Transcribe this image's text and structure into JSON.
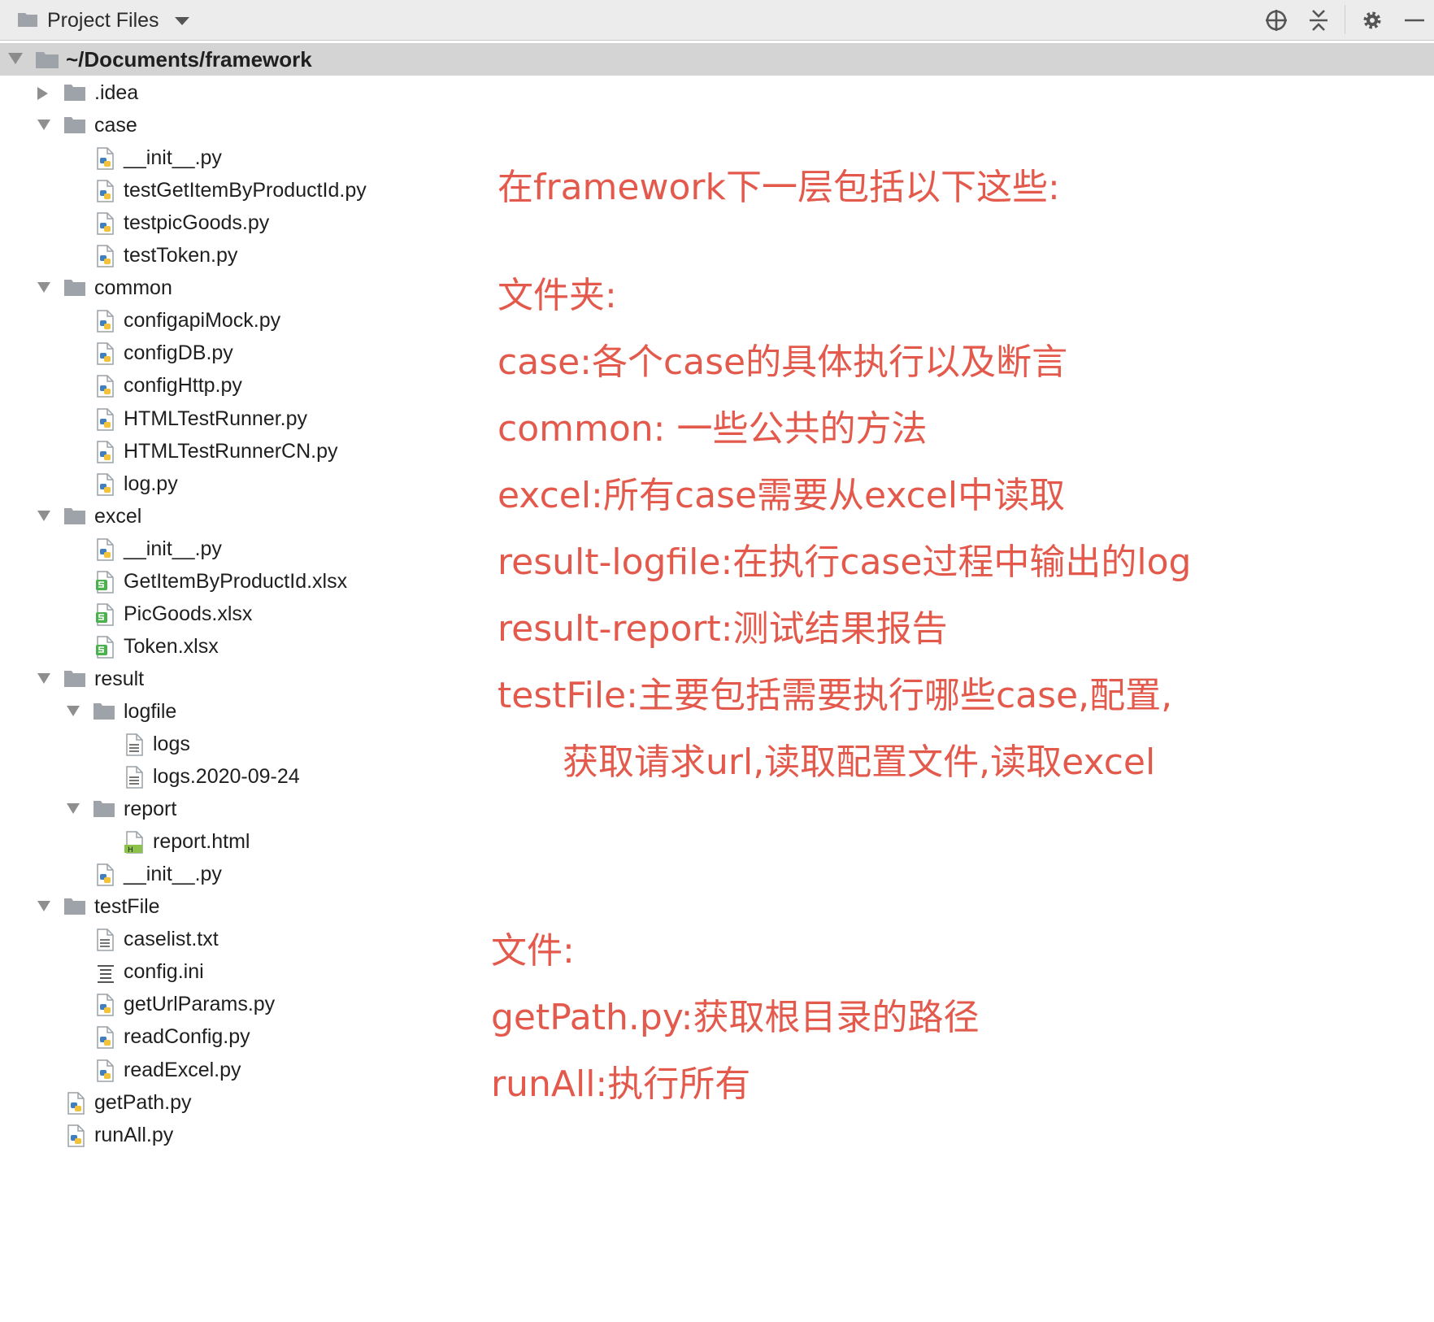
{
  "toolbar": {
    "title": "Project Files",
    "icons": [
      "folder-icon",
      "dropdown-caret-icon",
      "locate-target-icon",
      "collapse-all-icon",
      "gear-icon",
      "minimize-icon"
    ]
  },
  "tree": {
    "root_label": "~/Documents/framework",
    "items": [
      {
        "label": ".idea",
        "type": "folder",
        "expanded": false
      },
      {
        "label": "case",
        "type": "folder",
        "expanded": true
      },
      {
        "label": "__init__.py",
        "type": "python"
      },
      {
        "label": "testGetItemByProductId.py",
        "type": "python"
      },
      {
        "label": "testpicGoods.py",
        "type": "python"
      },
      {
        "label": "testToken.py",
        "type": "python"
      },
      {
        "label": "common",
        "type": "folder",
        "expanded": true
      },
      {
        "label": "configapiMock.py",
        "type": "python"
      },
      {
        "label": "configDB.py",
        "type": "python"
      },
      {
        "label": "configHttp.py",
        "type": "python"
      },
      {
        "label": "HTMLTestRunner.py",
        "type": "python"
      },
      {
        "label": "HTMLTestRunnerCN.py",
        "type": "python"
      },
      {
        "label": "log.py",
        "type": "python"
      },
      {
        "label": "excel",
        "type": "folder",
        "expanded": true
      },
      {
        "label": "__init__.py",
        "type": "python"
      },
      {
        "label": "GetItemByProductId.xlsx",
        "type": "excel"
      },
      {
        "label": "PicGoods.xlsx",
        "type": "excel"
      },
      {
        "label": "Token.xlsx",
        "type": "excel"
      },
      {
        "label": "result",
        "type": "folder",
        "expanded": true
      },
      {
        "label": "logfile",
        "type": "folder",
        "expanded": true
      },
      {
        "label": "logs",
        "type": "text"
      },
      {
        "label": "logs.2020-09-24",
        "type": "text"
      },
      {
        "label": "report",
        "type": "folder",
        "expanded": true
      },
      {
        "label": "report.html",
        "type": "html"
      },
      {
        "label": "__init__.py",
        "type": "python"
      },
      {
        "label": "testFile",
        "type": "folder",
        "expanded": true
      },
      {
        "label": "caselist.txt",
        "type": "text"
      },
      {
        "label": "config.ini",
        "type": "ini"
      },
      {
        "label": "getUrlParams.py",
        "type": "python"
      },
      {
        "label": "readConfig.py",
        "type": "python"
      },
      {
        "label": "readExcel.py",
        "type": "python"
      },
      {
        "label": "getPath.py",
        "type": "python"
      },
      {
        "label": "runAll.py",
        "type": "python"
      }
    ]
  },
  "notes": {
    "intro": "在framework下一层包括以下这些:",
    "folders_heading": "文件夹:",
    "case": "case:各个case的具体执行以及断言",
    "common": "common: 一些公共的方法",
    "excel": "excel:所有case需要从excel中读取",
    "result_logfile": "result-logfile:在执行case过程中输出的log",
    "result_report": "result-report:测试结果报告",
    "testfile_line1": "testFile:主要包括需要执行哪些case,配置,",
    "testfile_line2": "获取请求url,读取配置文件,读取excel",
    "files_heading": "文件:",
    "getpath": "getPath.py:获取根目录的路径",
    "runall": "runAll:执行所有"
  },
  "colors": {
    "annotation_red": "#e35a4d",
    "toolbar_bg": "#ececec",
    "selected_row_bg": "#d4d4d4"
  }
}
